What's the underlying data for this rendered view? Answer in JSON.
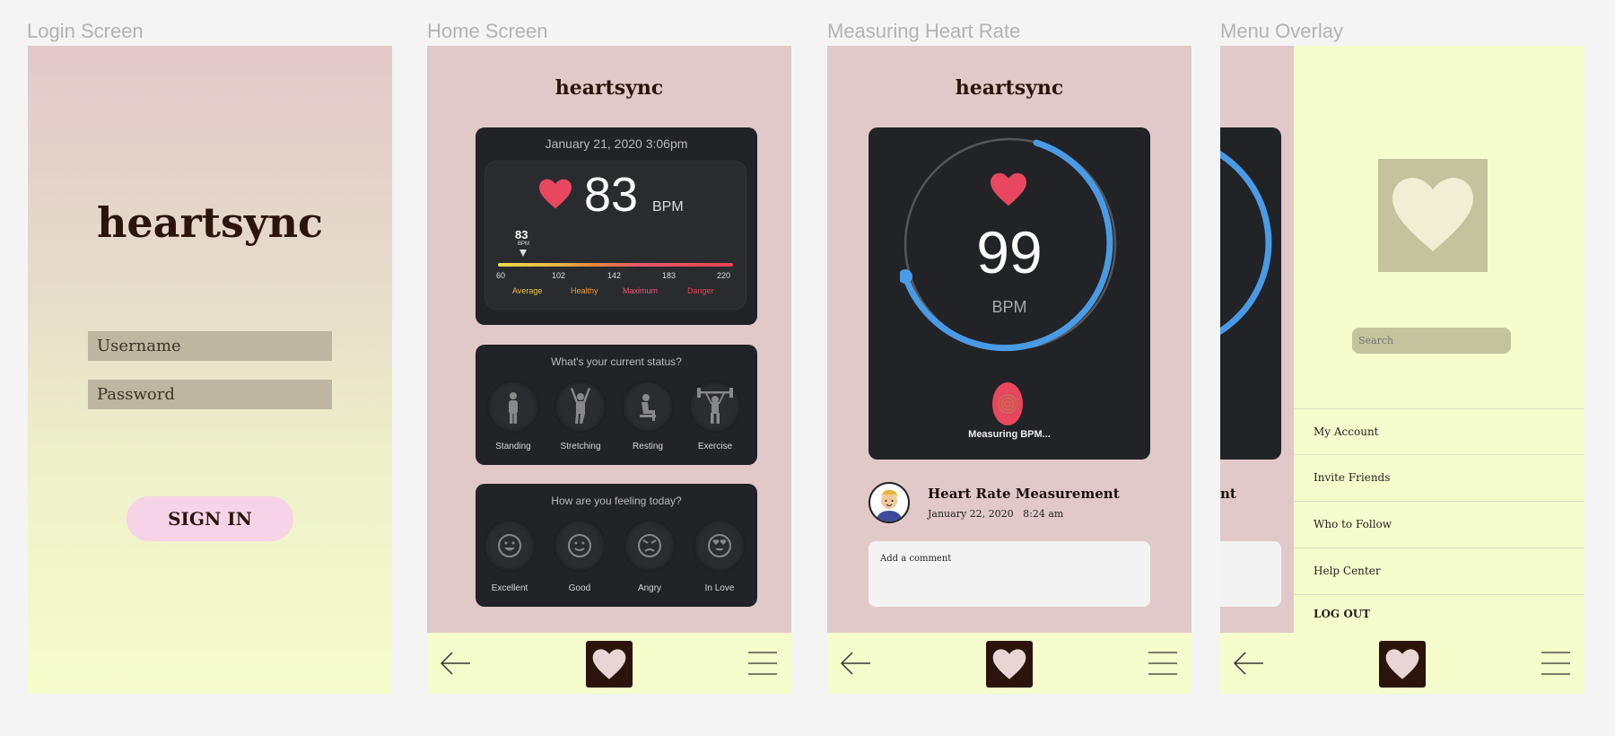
{
  "frames": {
    "login": "Login Screen",
    "home": "Home Screen",
    "measure": "Measuring Heart Rate",
    "menu": "Menu Overlay"
  },
  "app": {
    "name": "heartsync"
  },
  "login": {
    "username_placeholder": "Username",
    "password_placeholder": "Password",
    "signin_label": "SIGN IN"
  },
  "home": {
    "timestamp": "January 21, 2020  3:06pm",
    "bpm": "83",
    "bpm_unit": "BPM",
    "marker_value": "83",
    "marker_unit": "BPM",
    "scale": [
      "60",
      "102",
      "142",
      "183",
      "220"
    ],
    "zones": [
      "Average",
      "Healthy",
      "Maximum",
      "Danger"
    ],
    "status_question": "What's your current status?",
    "statuses": [
      "Standing",
      "Stretching",
      "Resting",
      "Exercise"
    ],
    "feeling_question": "How are you feeling today?",
    "feelings": [
      "Excellent",
      "Good",
      "Angry",
      "In Love"
    ]
  },
  "measure": {
    "bpm": "99",
    "bpm_unit": "BPM",
    "measuring_text": "Measuring BPM...",
    "entry_title": "Heart Rate Measurement",
    "entry_date": "January 22, 2020   8:24 am",
    "comment_placeholder": "Add a comment",
    "partial_title": "nt"
  },
  "menu": {
    "search_placeholder": "Search",
    "items": [
      "My Account",
      "Invite Friends",
      "Who to Follow",
      "Help Center"
    ],
    "logout": "LOG OUT"
  },
  "colors": {
    "pink_bg": "#e2c9c9",
    "cream": "#f5fdcc",
    "dark_brown": "#2a140c",
    "heart_red": "#e8475f",
    "ring_blue": "#4a9be6",
    "card_dark": "#222326"
  }
}
